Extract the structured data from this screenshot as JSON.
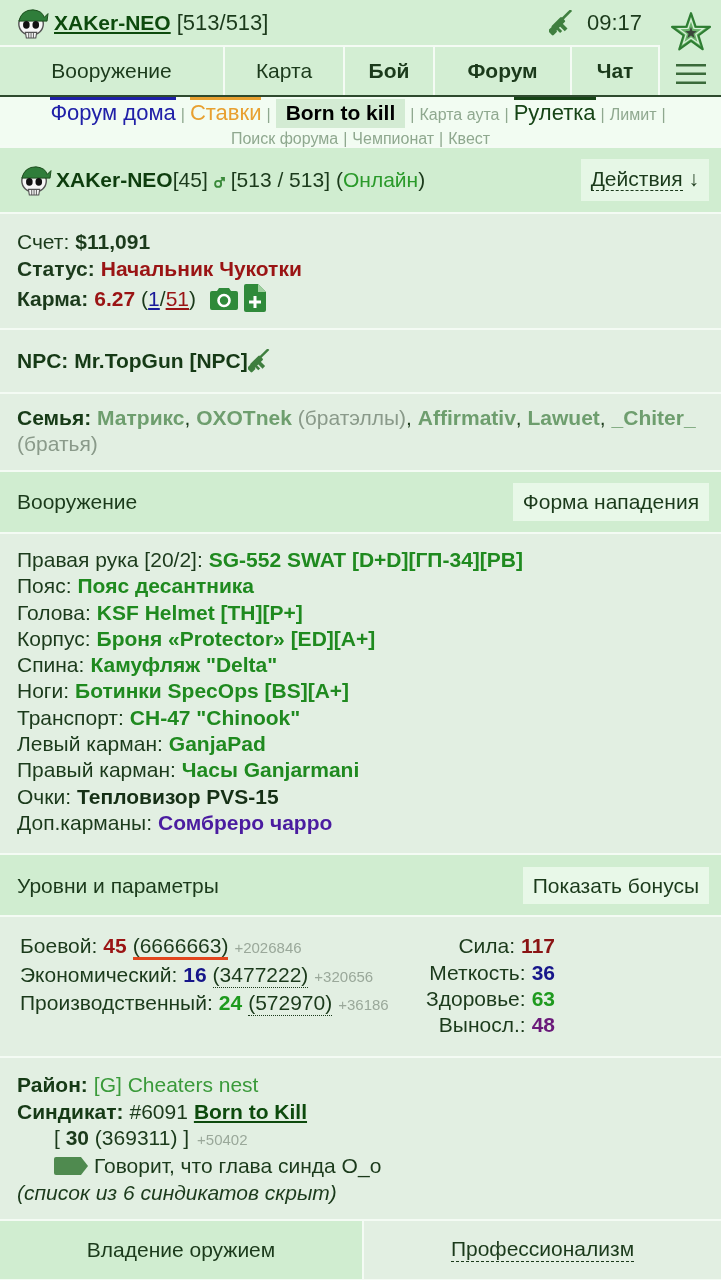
{
  "header": {
    "username": "XAKer-NEO",
    "hp": "[513/513]",
    "time": "09:17"
  },
  "nav": {
    "tabs": [
      {
        "label": "Вооружение",
        "highlighted": false
      },
      {
        "label": "Карта",
        "highlighted": false
      },
      {
        "label": "Бой",
        "highlighted": true
      },
      {
        "label": "Форум",
        "highlighted": true
      },
      {
        "label": "Чат",
        "highlighted": true
      }
    ]
  },
  "forum_nav": {
    "items": [
      {
        "kind": "featured",
        "label": "Форум дома",
        "color": "#2020a8",
        "selected": false
      },
      {
        "kind": "separator",
        "label": "|"
      },
      {
        "kind": "featured",
        "label": "Ставки",
        "color": "#e8a030",
        "selected": false
      },
      {
        "kind": "separator",
        "label": "|"
      },
      {
        "kind": "featured",
        "label": "Born to kill",
        "color": "#000000",
        "selected": true
      },
      {
        "kind": "separator",
        "label": "|"
      },
      {
        "kind": "minor",
        "label": "Карта аута",
        "selected": false
      },
      {
        "kind": "separator",
        "label": "|"
      },
      {
        "kind": "featured",
        "label": "Рулетка",
        "color": "#164416",
        "selected": false
      },
      {
        "kind": "separator",
        "label": "|"
      },
      {
        "kind": "minor",
        "label": "Лимит",
        "selected": false
      },
      {
        "kind": "separator",
        "label": "|"
      },
      {
        "kind": "minor",
        "label": "Поиск форума",
        "selected": false
      },
      {
        "kind": "separator",
        "label": "|"
      },
      {
        "kind": "minor",
        "label": "Чемпионат",
        "selected": false
      },
      {
        "kind": "separator",
        "label": "|"
      },
      {
        "kind": "minor",
        "label": "Квест",
        "selected": false
      }
    ]
  },
  "profile": {
    "name": "XAKer-NEO",
    "level": "[45]",
    "hp": "[513 / 513]",
    "status_open": "(",
    "status": "Онлайн",
    "status_close": ")",
    "actions": {
      "label": "Действия",
      "arrow": "↓"
    }
  },
  "account": {
    "balance": {
      "label": "Счет:",
      "value": "$11,091"
    },
    "status": {
      "label": "Статус:",
      "value": "Начальник Чукотки"
    },
    "karma": {
      "label": "Карма:",
      "value": "6.27",
      "open": "(",
      "plus": "1",
      "sep": "/",
      "minus": "51",
      "close": ")"
    }
  },
  "npc": {
    "label": "NPC:",
    "name": "Mr.TopGun [NPC]"
  },
  "family": {
    "label": "Семья:",
    "members": [
      {
        "name": "Матрикс",
        "after": ","
      },
      {
        "name": "OXOTnek",
        "relation": "(братэллы)",
        "after": ","
      },
      {
        "name": "Affirmativ",
        "after": ","
      },
      {
        "name": "Lawuet",
        "after": ","
      },
      {
        "name": "_Chiter_",
        "relation": "(братья)"
      }
    ]
  },
  "equipment_section": {
    "title": "Вооружение",
    "button": "Форма нападения"
  },
  "equipment": [
    {
      "slot": "Правая рука [20/2]:",
      "item": "SG-552 SWAT [D+D][ГП-34][PB]",
      "color": "#1f8a1f"
    },
    {
      "slot": "Пояс:",
      "item": "Пояс десантника",
      "color": "#1f8a1f"
    },
    {
      "slot": "Голова:",
      "item": "KSF Helmet [TH][P+]",
      "color": "#1f8a1f"
    },
    {
      "slot": "Корпус:",
      "item": "Броня «Protector» [ED][A+]",
      "color": "#1f8a1f"
    },
    {
      "slot": "Спина:",
      "item": "Камуфляж \"Delta\"",
      "color": "#1f8a1f"
    },
    {
      "slot": "Ноги:",
      "item": "Ботинки SpecOps [BS][A+]",
      "color": "#1f8a1f"
    },
    {
      "slot": "Транспорт:",
      "item": "CH-47 \"Chinook\"",
      "color": "#1f8a1f"
    },
    {
      "slot": "Левый карман:",
      "item": "GanjaPad",
      "color": "#1f8a1f"
    },
    {
      "slot": "Правый карман:",
      "item": "Часы Ganjarmani",
      "color": "#1f8a1f"
    },
    {
      "slot": "Очки:",
      "item": "Тепловизор PVS-15",
      "color": "#163016"
    },
    {
      "slot": "Доп.карманы:",
      "item": "Сомбреро чарро",
      "color": "#4a1ca0"
    }
  ],
  "levels_section": {
    "title": "Уровни и параметры",
    "button": "Показать бонусы"
  },
  "levels": [
    {
      "label": "Боевой:",
      "level": "45",
      "exp": "(6666663)",
      "gain": "+2026846",
      "color": "#9a1414",
      "marked": true
    },
    {
      "label": "Экономический:",
      "level": "16",
      "exp": "(3477222)",
      "gain": "+320656",
      "color": "#16168a",
      "marked": false
    },
    {
      "label": "Производственный:",
      "level": "24",
      "exp": "(572970)",
      "gain": "+36186",
      "color": "#1e9a1e",
      "marked": false
    }
  ],
  "stats": [
    {
      "label": "Сила:",
      "value": "117",
      "color": "#8a1414"
    },
    {
      "label": "Меткость:",
      "value": "36",
      "color": "#16168a"
    },
    {
      "label": "Здоровье:",
      "value": "63",
      "color": "#1e9a1e"
    },
    {
      "label": "Выносл.:",
      "value": "48",
      "color": "#6a1a7a"
    }
  ],
  "district": {
    "label": "Район:",
    "value": "[G] Cheaters nest"
  },
  "syndicate": {
    "label": "Синдикат:",
    "number": "#6091",
    "name": "Born to Kill",
    "rank": "[ **30** (369311) ]",
    "gain": "+50402",
    "note": "Говорит, что глава синда О_о",
    "hidden": "(список из 6 синдикатов скрыт)"
  },
  "bottom_tabs": [
    {
      "label": "Владение оружием",
      "selected": true
    },
    {
      "label": "Профессионализм",
      "selected": false
    }
  ]
}
